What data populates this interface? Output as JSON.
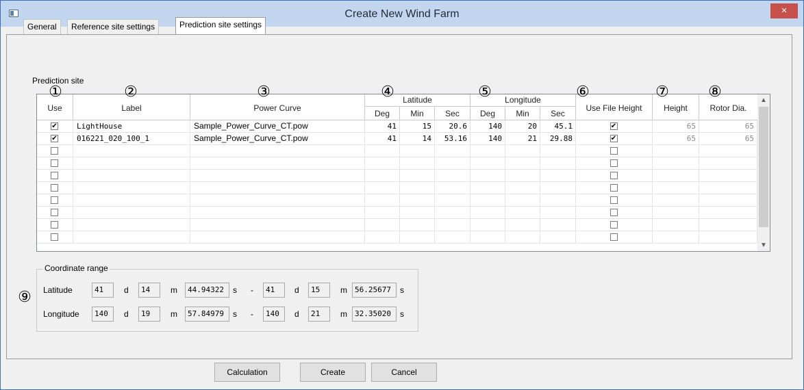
{
  "window": {
    "title": "Create New Wind Farm",
    "close_glyph": "×"
  },
  "tabs": [
    {
      "label": "General"
    },
    {
      "label": "Reference site settings"
    },
    {
      "label": "Prediction site settings"
    }
  ],
  "prediction_site": {
    "section_label": "Prediction site",
    "headers": {
      "use": "Use",
      "label": "Label",
      "power_curve": "Power Curve",
      "latitude": "Latitude",
      "longitude": "Longitude",
      "deg": "Deg",
      "min": "Min",
      "sec": "Sec",
      "use_file_height": "Use File Height",
      "height": "Height",
      "rotor_dia": "Rotor Dia."
    },
    "rows": [
      {
        "use": true,
        "label": "LightHouse",
        "power_curve": "Sample_Power_Curve_CT.pow",
        "lat_deg": "41",
        "lat_min": "15",
        "lat_sec": "20.6",
        "lon_deg": "140",
        "lon_min": "20",
        "lon_sec": "45.1",
        "use_file_height": true,
        "height": "65",
        "rotor_dia": "65"
      },
      {
        "use": true,
        "label": "016221_020_100_1",
        "power_curve": "Sample_Power_Curve_CT.pow",
        "lat_deg": "41",
        "lat_min": "14",
        "lat_sec": "53.16",
        "lon_deg": "140",
        "lon_min": "21",
        "lon_sec": "29.88",
        "use_file_height": true,
        "height": "65",
        "rotor_dia": "65"
      },
      {
        "use": false,
        "use_file_height": false
      },
      {
        "use": false,
        "use_file_height": false
      },
      {
        "use": false,
        "use_file_height": false
      },
      {
        "use": false,
        "use_file_height": false
      },
      {
        "use": false,
        "use_file_height": false
      },
      {
        "use": false,
        "use_file_height": false
      },
      {
        "use": false,
        "use_file_height": false
      },
      {
        "use": false,
        "use_file_height": false
      }
    ],
    "markers": [
      "①",
      "②",
      "③",
      "④",
      "⑤",
      "⑥",
      "⑦",
      "⑧",
      "⑨"
    ]
  },
  "coordinate_range": {
    "title": "Coordinate range",
    "units": {
      "d": "d",
      "m": "m",
      "s": "s",
      "dash": "-"
    },
    "latitude": {
      "label": "Latitude",
      "from": {
        "deg": "41",
        "min": "14",
        "sec": "44.94322"
      },
      "to": {
        "deg": "41",
        "min": "15",
        "sec": "56.25677"
      }
    },
    "longitude": {
      "label": "Longitude",
      "from": {
        "deg": "140",
        "min": "19",
        "sec": "57.84979"
      },
      "to": {
        "deg": "140",
        "min": "21",
        "sec": "32.35020"
      }
    }
  },
  "buttons": {
    "calculation": "Calculation",
    "create": "Create",
    "cancel": "Cancel"
  },
  "icons": {
    "check": "✔",
    "scroll_up": "▲",
    "scroll_down": "▼"
  }
}
